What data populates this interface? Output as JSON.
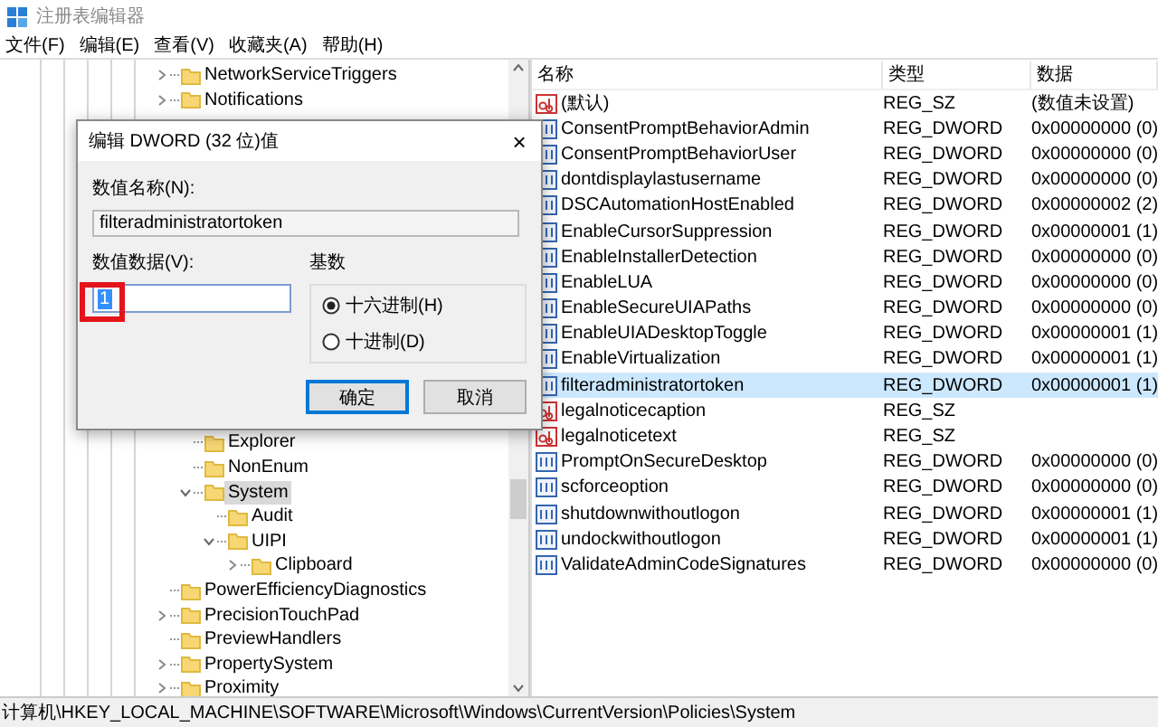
{
  "window": {
    "title": "注册表编辑器"
  },
  "menu": [
    "文件(F)",
    "编辑(E)",
    "查看(V)",
    "收藏夹(A)",
    "帮助(H)"
  ],
  "tree": {
    "items": [
      {
        "label": "NetworkServiceTriggers",
        "expanded": false,
        "selected": false
      },
      {
        "label": "Notifications",
        "expanded": false,
        "selected": false
      },
      {
        "children": [
          {
            "label": "Explorer",
            "selected": false
          },
          {
            "label": "NonEnum",
            "selected": false
          },
          {
            "label": "System",
            "expanded": true,
            "selected": true,
            "children": [
              {
                "label": "Audit",
                "selected": false
              },
              {
                "label": "UIPI",
                "expanded": true,
                "selected": false,
                "children": [
                  {
                    "label": "Clipboard",
                    "expanded": false,
                    "selected": false
                  }
                ]
              }
            ]
          }
        ]
      },
      {
        "label": "PowerEfficiencyDiagnostics",
        "selected": false
      },
      {
        "label": "PrecisionTouchPad",
        "expanded": false,
        "selected": false
      },
      {
        "label": "PreviewHandlers",
        "selected": false
      },
      {
        "label": "PropertySystem",
        "expanded": false,
        "selected": false
      },
      {
        "label": "Proximity",
        "expanded": false,
        "selected": false
      }
    ]
  },
  "values": {
    "columns": [
      "名称",
      "类型",
      "数据"
    ],
    "rows": [
      {
        "kind": "sz",
        "name": "(默认)",
        "type": "REG_SZ",
        "data": "(数值未设置)",
        "selected": false
      },
      {
        "kind": "dword",
        "name": "ConsentPromptBehaviorAdmin",
        "type": "REG_DWORD",
        "data": "0x00000000 (0)",
        "selected": false
      },
      {
        "kind": "dword",
        "name": "ConsentPromptBehaviorUser",
        "type": "REG_DWORD",
        "data": "0x00000000 (0)",
        "selected": false
      },
      {
        "kind": "dword",
        "name": "dontdisplaylastusername",
        "type": "REG_DWORD",
        "data": "0x00000000 (0)",
        "selected": false
      },
      {
        "kind": "dword",
        "name": "DSCAutomationHostEnabled",
        "type": "REG_DWORD",
        "data": "0x00000002 (2)",
        "selected": false
      },
      {
        "kind": "dword",
        "name": "EnableCursorSuppression",
        "type": "REG_DWORD",
        "data": "0x00000001 (1)",
        "selected": false
      },
      {
        "kind": "dword",
        "name": "EnableInstallerDetection",
        "type": "REG_DWORD",
        "data": "0x00000000 (0)",
        "selected": false
      },
      {
        "kind": "dword",
        "name": "EnableLUA",
        "type": "REG_DWORD",
        "data": "0x00000000 (0)",
        "selected": false
      },
      {
        "kind": "dword",
        "name": "EnableSecureUIAPaths",
        "type": "REG_DWORD",
        "data": "0x00000000 (0)",
        "selected": false
      },
      {
        "kind": "dword",
        "name": "EnableUIADesktopToggle",
        "type": "REG_DWORD",
        "data": "0x00000001 (1)",
        "selected": false
      },
      {
        "kind": "dword",
        "name": "EnableVirtualization",
        "type": "REG_DWORD",
        "data": "0x00000001 (1)",
        "selected": false
      },
      {
        "kind": "dword",
        "name": "filteradministratortoken",
        "type": "REG_DWORD",
        "data": "0x00000001 (1)",
        "selected": true
      },
      {
        "kind": "sz",
        "name": "legalnoticecaption",
        "type": "REG_SZ",
        "selected": false
      },
      {
        "kind": "sz",
        "name": "legalnoticetext",
        "type": "REG_SZ",
        "selected": false
      },
      {
        "kind": "dword",
        "name": "PromptOnSecureDesktop",
        "type": "REG_DWORD",
        "data": "0x00000000 (0)",
        "selected": false
      },
      {
        "kind": "dword",
        "name": "scforceoption",
        "type": "REG_DWORD",
        "data": "0x00000000 (0)",
        "selected": false
      },
      {
        "kind": "dword",
        "name": "shutdownwithoutlogon",
        "type": "REG_DWORD",
        "data": "0x00000001 (1)",
        "selected": false
      },
      {
        "kind": "dword",
        "name": "undockwithoutlogon",
        "type": "REG_DWORD",
        "data": "0x00000001 (1)",
        "selected": false
      },
      {
        "kind": "dword",
        "name": "ValidateAdminCodeSignatures",
        "type": "REG_DWORD",
        "data": "0x00000000 (0)",
        "selected": false
      }
    ]
  },
  "dialog": {
    "title": "编辑 DWORD (32 位)值",
    "close": "×",
    "name_label": "数值名称(N):",
    "name_value": "filteradministratortoken",
    "data_label": "数值数据(V):",
    "data_value": "1",
    "data_highlighted": true,
    "base_label": "基数",
    "base_options": [
      {
        "label": "十六进制(H)",
        "selected": true
      },
      {
        "label": "十进制(D)",
        "selected": false
      }
    ],
    "buttons": [
      {
        "label": "确定",
        "default": true
      },
      {
        "label": "取消",
        "default": false
      }
    ]
  },
  "status_bar": "计算机\\HKEY_LOCAL_MACHINE\\SOFTWARE\\Microsoft\\Windows\\CurrentVersion\\Policies\\System"
}
